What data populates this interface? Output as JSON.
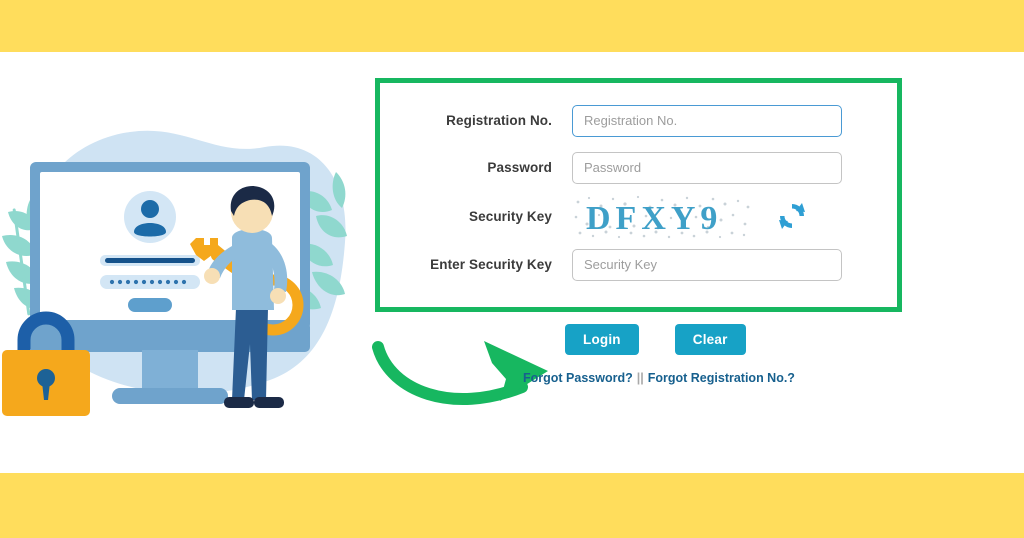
{
  "page": {
    "background_color": "#ffffff",
    "band_color": "#ffdd5c",
    "highlight_color": "#17b760",
    "accent_color": "#17a2c6",
    "link_color": "#17608e"
  },
  "illustration": {
    "alt": "login security illustration with monitor, padlock and person holding key",
    "monitor_frame_color": "#6fa3cc",
    "blob_color": "#cfe3f3",
    "leaf_color": "#8fd8ce",
    "padlock_body_color": "#f5a81c",
    "padlock_shackle_color": "#1d5fa8",
    "key_color": "#f5a81c",
    "person_shirt_color": "#8fbcdc",
    "person_pants_color": "#2c5d92",
    "person_hair_color": "#1b2a46",
    "person_skin_color": "#f7dfb5"
  },
  "form": {
    "fields": [
      {
        "label": "Registration No.",
        "placeholder": "Registration No.",
        "value": "",
        "type": "text",
        "focused": true
      },
      {
        "label": "Password",
        "placeholder": "Password",
        "value": "",
        "type": "password",
        "focused": false
      }
    ],
    "captcha": {
      "label": "Security Key",
      "text": "DFXY9",
      "refresh_icon": "refresh-icon"
    },
    "captcha_input": {
      "label": "Enter Security Key",
      "placeholder": "Security Key",
      "value": ""
    }
  },
  "buttons": {
    "login_label": "Login",
    "clear_label": "Clear"
  },
  "links": {
    "forgot_password": "Forgot Password?",
    "separator": "||",
    "forgot_registration": "Forgot Registration No.?"
  },
  "annotation": {
    "arrow_color": "#17b760",
    "arrow_target": "login-button",
    "box_target": "login-form-box"
  }
}
